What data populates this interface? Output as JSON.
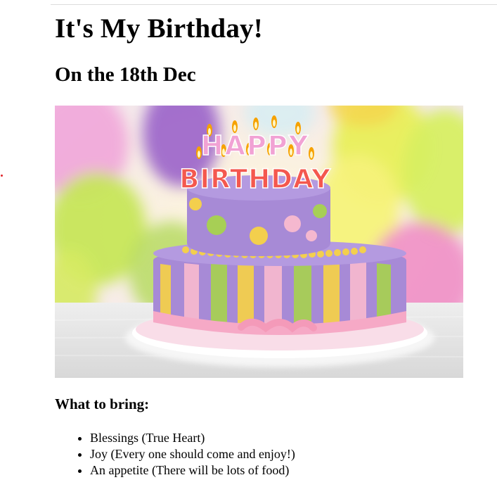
{
  "page": {
    "title": "It's My Birthday!",
    "subtitle": "On the 18th Dec",
    "image_alt": "Birthday cake with Happy Birthday candles",
    "cake_candle_text": {
      "line1": "HAPPY",
      "line2": "BIRTHDAY"
    },
    "list_heading": "What to bring:",
    "items": [
      "Blessings (True Heart)",
      "Joy (Every one should come and enjoy!)",
      "An appetite (There will be lots of food)"
    ]
  },
  "colors": {
    "cake_purple": "#a78ad6",
    "cake_pink": "#f5b8cf",
    "cake_yellow": "#f3cf4d",
    "cake_green": "#a7cf55",
    "balloon_yellow": "#e8ef5a",
    "balloon_purple": "#9a63c9"
  }
}
